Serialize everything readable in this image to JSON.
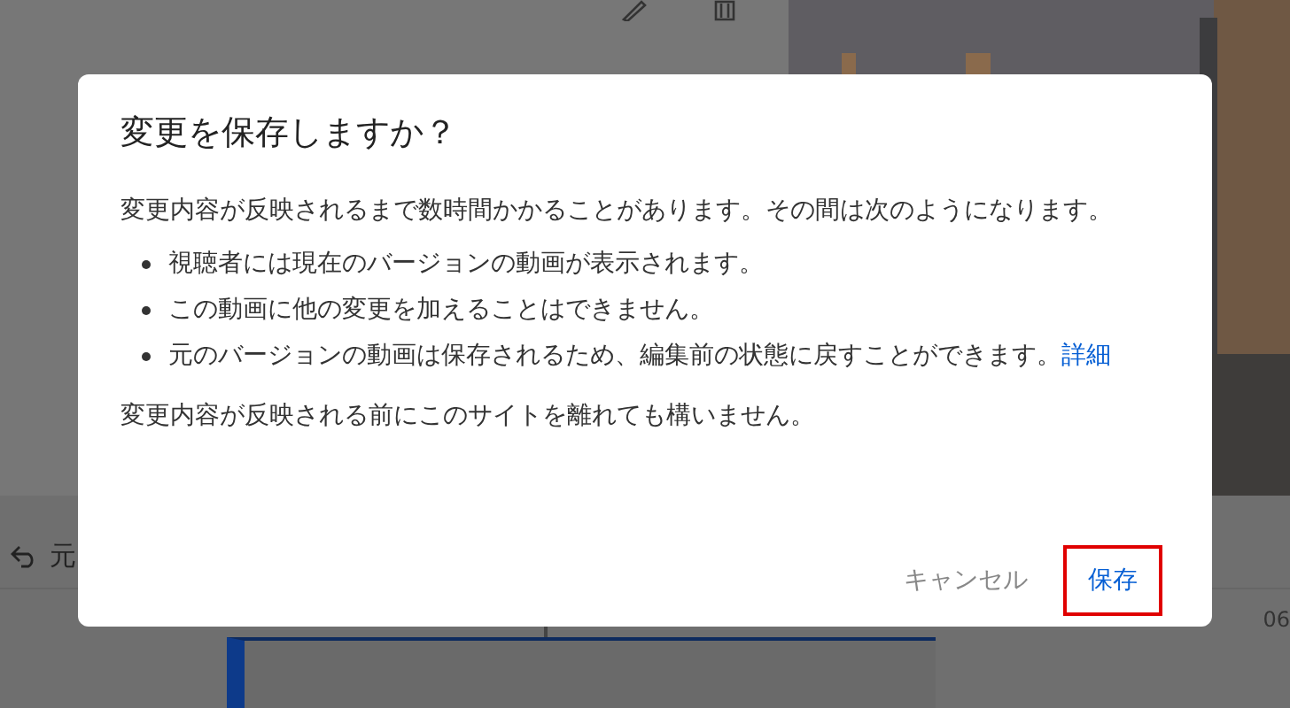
{
  "editor": {
    "toolbar_text": "元",
    "timeline_label": "06"
  },
  "dialog": {
    "title": "変更を保存しますか？",
    "intro": "変更内容が反映されるまで数時間かかることがあります。その間は次のようになります。",
    "bullets": [
      {
        "text": "視聴者には現在のバージョンの動画が表示されます。"
      },
      {
        "text": "この動画に他の変更を加えることはできません。"
      },
      {
        "text": "元のバージョンの動画は保存されるため、編集前の状態に戻すことができます。",
        "link": "詳細"
      }
    ],
    "note": "変更内容が反映される前にこのサイトを離れても構いません。",
    "buttons": [
      {
        "label": "キャンセル",
        "kind": "cancel",
        "highlighted": false
      },
      {
        "label": "保存",
        "kind": "primary",
        "highlighted": true
      }
    ]
  }
}
